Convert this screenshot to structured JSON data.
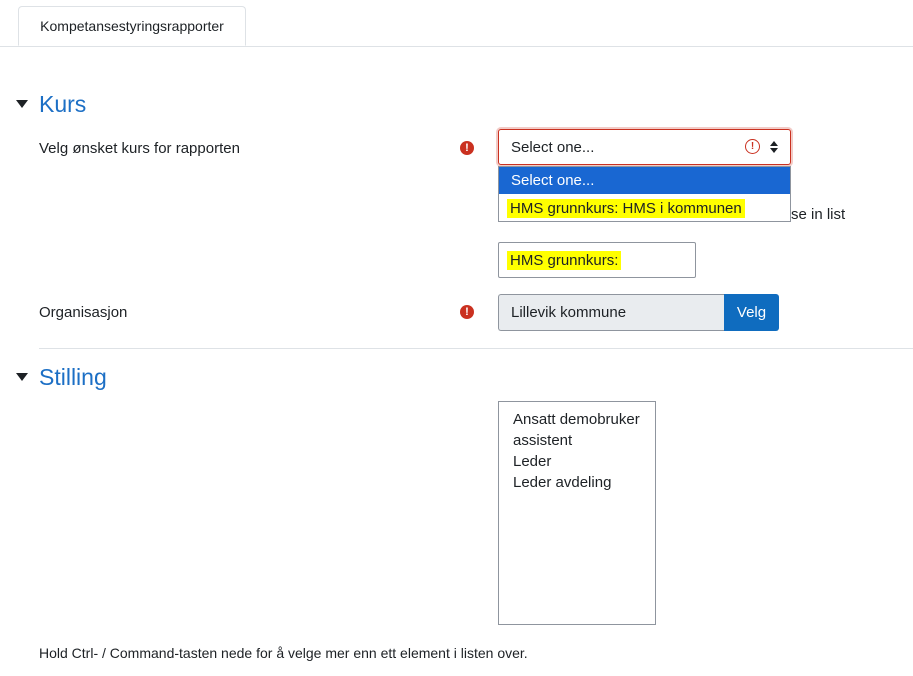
{
  "tabs": [
    {
      "label": "Kompetansestyringsrapporter"
    }
  ],
  "sections": {
    "kurs": {
      "title": "Kurs"
    },
    "stilling": {
      "title": "Stilling"
    }
  },
  "course": {
    "label": "Velg ønsket kurs for rapporten",
    "select_value": "Select one...",
    "options": [
      "Select one...",
      "HMS grunnkurs: HMS i kommunen"
    ],
    "obscured_text": "rse in list",
    "search_value": "HMS grunnkurs:"
  },
  "organisation": {
    "label": "Organisasjon",
    "value": "Lillevik kommune",
    "button": "Velg"
  },
  "position_list": [
    "Ansatt demobruker",
    "assistent",
    "Leder",
    "Leder avdeling"
  ],
  "help_text": "Hold Ctrl- / Command-tasten nede for å velge mer enn ett element i listen over.",
  "colors": {
    "accent": "#1c6fc5",
    "error": "#ca3120",
    "highlight": "#ffff00",
    "button": "#0f6cbf"
  },
  "icons": {
    "required": "exclamation-circle-icon",
    "select-arrows": "chevron-up-down-icon",
    "collapse": "caret-down-icon"
  }
}
